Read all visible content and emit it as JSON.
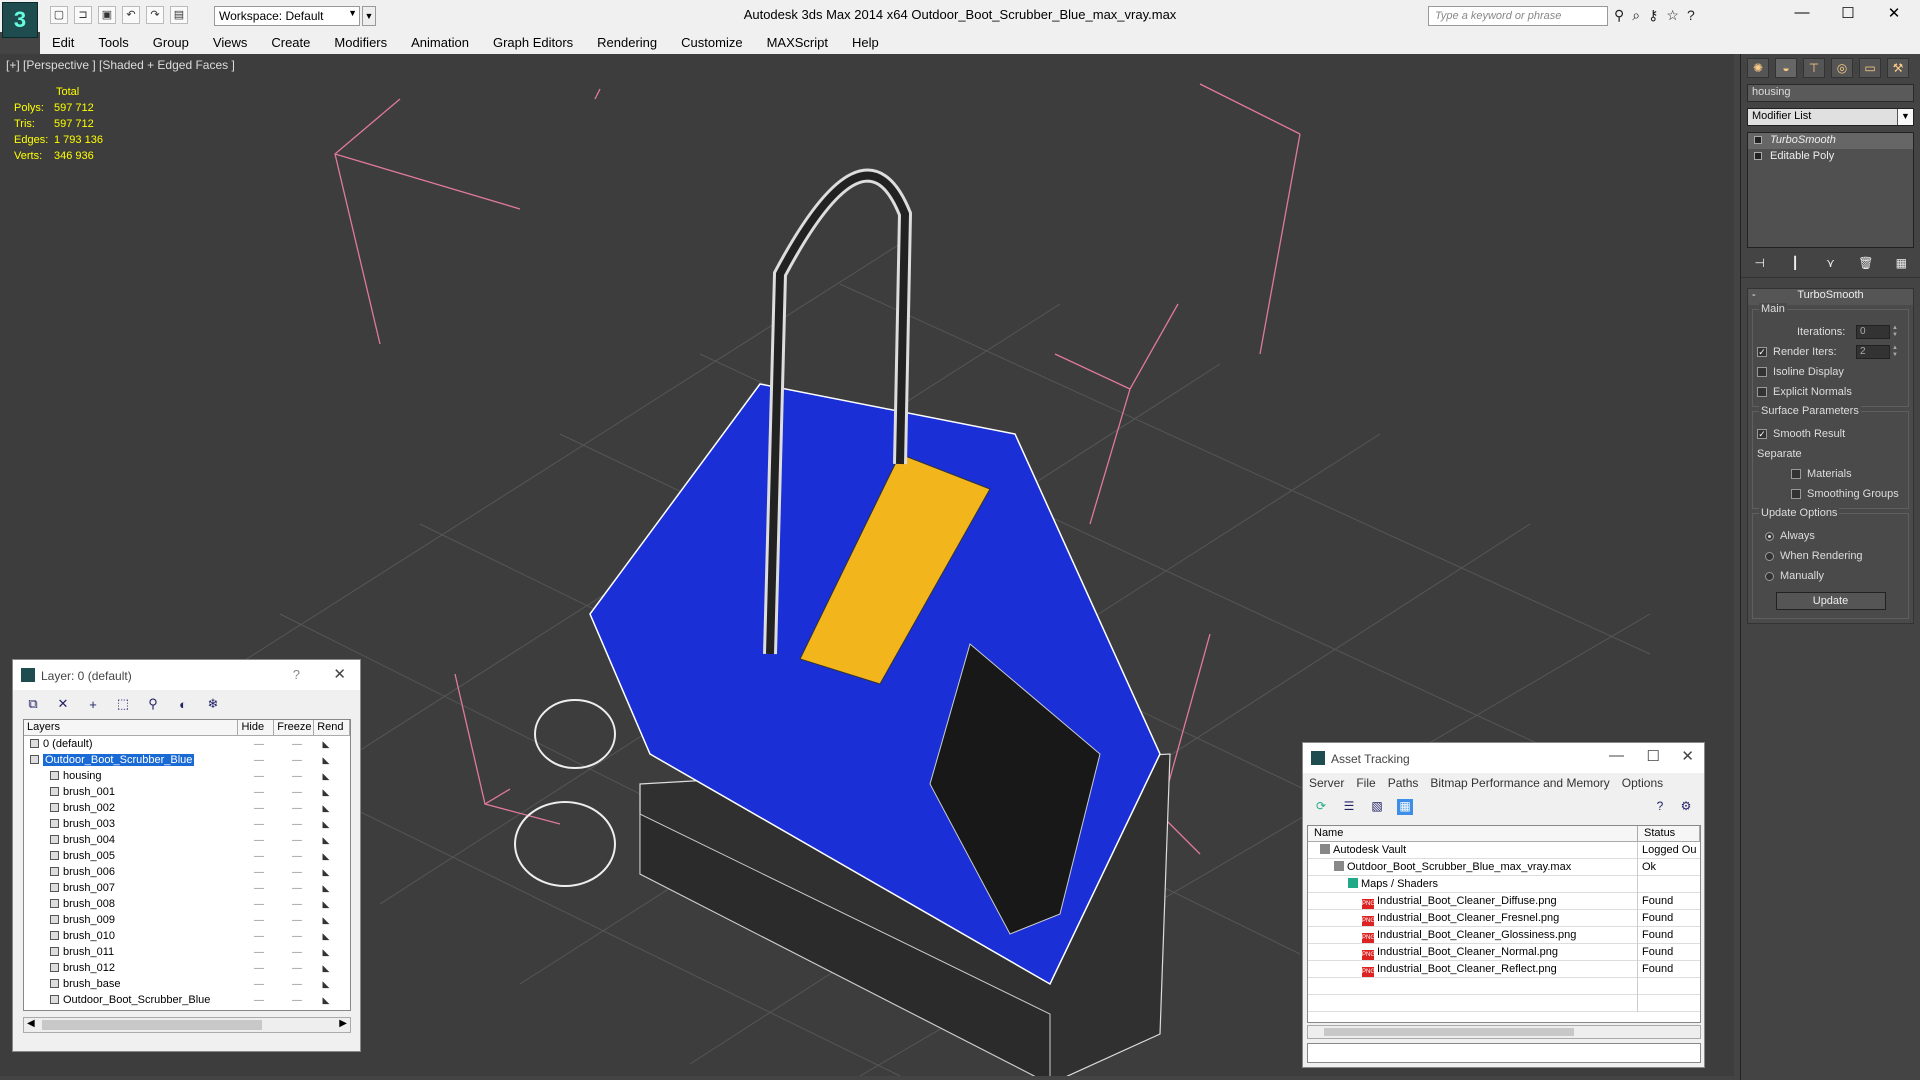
{
  "app": {
    "title": "Autodesk 3ds Max  2014 x64      Outdoor_Boot_Scrubber_Blue_max_vray.max",
    "logo": "3",
    "workspace": "Workspace: Default",
    "search_placeholder": "Type a keyword or phrase"
  },
  "menu": [
    "Edit",
    "Tools",
    "Group",
    "Views",
    "Create",
    "Modifiers",
    "Animation",
    "Graph Editors",
    "Rendering",
    "Customize",
    "MAXScript",
    "Help"
  ],
  "viewport": {
    "label": "[+] [Perspective ] [Shaded + Edged Faces ]",
    "stats": {
      "header": "Total",
      "rows": [
        {
          "label": "Polys:",
          "value": "597 712"
        },
        {
          "label": "Tris:",
          "value": "597 712"
        },
        {
          "label": "Edges:",
          "value": "1 793 136"
        },
        {
          "label": "Verts:",
          "value": "346 936"
        }
      ]
    },
    "colors": {
      "wire_blue": "#1a2fd6",
      "label_yellow": "#f2b51c",
      "selection_box": "#e07a9a",
      "grid": "#555555"
    }
  },
  "command_panel": {
    "object_name": "housing",
    "modifier_list": "Modifier List",
    "stack": [
      "TurboSmooth",
      "Editable Poly"
    ],
    "rollout_title": "TurboSmooth",
    "main": {
      "title": "Main",
      "iterations_label": "Iterations:",
      "iterations_value": "0",
      "render_iters_label": "Render Iters:",
      "render_iters_value": "2",
      "isoline": "Isoline Display",
      "explicit": "Explicit Normals"
    },
    "surface": {
      "title": "Surface Parameters",
      "smooth": "Smooth Result",
      "separate": "Separate",
      "materials": "Materials",
      "smoothing_groups": "Smoothing Groups"
    },
    "update": {
      "title": "Update Options",
      "always": "Always",
      "when_rendering": "When Rendering",
      "manually": "Manually",
      "button": "Update"
    }
  },
  "layer_window": {
    "title": "Layer: 0 (default)",
    "help": "?",
    "columns": [
      "Layers",
      "Hide",
      "Freeze",
      "Rend"
    ],
    "rows": [
      {
        "name": "0 (default)",
        "indent": 0,
        "layer": true
      },
      {
        "name": "Outdoor_Boot_Scrubber_Blue",
        "indent": 0,
        "layer": true,
        "selected": true
      },
      {
        "name": "housing",
        "indent": 1
      },
      {
        "name": "brush_001",
        "indent": 1
      },
      {
        "name": "brush_002",
        "indent": 1
      },
      {
        "name": "brush_003",
        "indent": 1
      },
      {
        "name": "brush_004",
        "indent": 1
      },
      {
        "name": "brush_005",
        "indent": 1
      },
      {
        "name": "brush_006",
        "indent": 1
      },
      {
        "name": "brush_007",
        "indent": 1
      },
      {
        "name": "brush_008",
        "indent": 1
      },
      {
        "name": "brush_009",
        "indent": 1
      },
      {
        "name": "brush_010",
        "indent": 1
      },
      {
        "name": "brush_011",
        "indent": 1
      },
      {
        "name": "brush_012",
        "indent": 1
      },
      {
        "name": "brush_base",
        "indent": 1
      },
      {
        "name": "Outdoor_Boot_Scrubber_Blue",
        "indent": 1
      }
    ]
  },
  "asset_tracking": {
    "title": "Asset Tracking",
    "menu": [
      "Server",
      "File",
      "Paths",
      "Bitmap Performance and Memory",
      "Options"
    ],
    "columns": [
      "Name",
      "Status"
    ],
    "rows": [
      {
        "name": "Autodesk Vault",
        "status": "Logged Ou",
        "indent": 0,
        "icon": "vault"
      },
      {
        "name": "Outdoor_Boot_Scrubber_Blue_max_vray.max",
        "status": "Ok",
        "indent": 1,
        "icon": "max"
      },
      {
        "name": "Maps / Shaders",
        "status": "",
        "indent": 2,
        "icon": "maps"
      },
      {
        "name": "Industrial_Boot_Cleaner_Diffuse.png",
        "status": "Found",
        "indent": 3,
        "icon": "png"
      },
      {
        "name": "Industrial_Boot_Cleaner_Fresnel.png",
        "status": "Found",
        "indent": 3,
        "icon": "png"
      },
      {
        "name": "Industrial_Boot_Cleaner_Glossiness.png",
        "status": "Found",
        "indent": 3,
        "icon": "png"
      },
      {
        "name": "Industrial_Boot_Cleaner_Normal.png",
        "status": "Found",
        "indent": 3,
        "icon": "png"
      },
      {
        "name": "Industrial_Boot_Cleaner_Reflect.png",
        "status": "Found",
        "indent": 3,
        "icon": "png"
      }
    ]
  }
}
